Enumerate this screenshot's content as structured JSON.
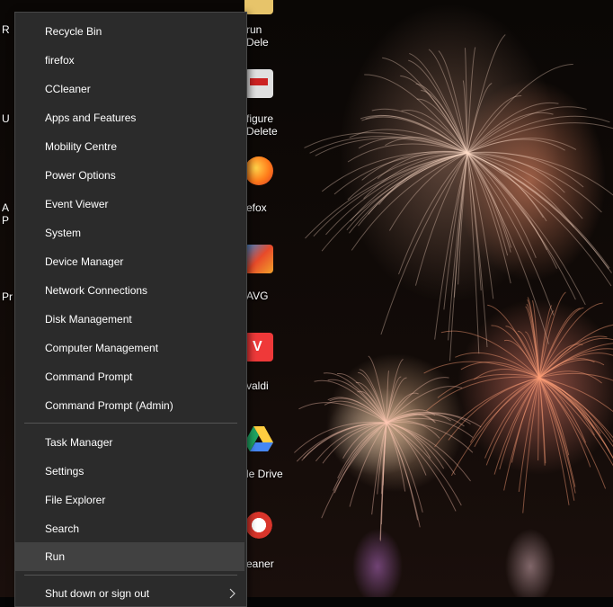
{
  "desktop": {
    "left_labels": [
      "R",
      "U",
      "A",
      "P",
      "Pr"
    ],
    "icons": [
      {
        "label_lines": [
          "run",
          "Dele"
        ],
        "icon": "run-icon",
        "color": "#e7c46a"
      },
      {
        "label_lines": [
          "figure",
          "Delete"
        ],
        "icon": "floppy-disk-icon",
        "color": "#e0e0e0"
      },
      {
        "label_lines": [
          "efox"
        ],
        "icon": "firefox-icon",
        "color": "#ff7b1a"
      },
      {
        "label_lines": [
          "AVG"
        ],
        "icon": "avg-icon",
        "color": "#e84a2a"
      },
      {
        "label_lines": [
          "valdi"
        ],
        "icon": "vivaldi-icon",
        "color": "#ef3939"
      },
      {
        "label_lines": [
          "le Drive"
        ],
        "icon": "google-drive-icon",
        "color": "#1fa463"
      },
      {
        "label_lines": [
          "eaner"
        ],
        "icon": "ccleaner-icon",
        "color": "#d9352b"
      }
    ]
  },
  "menu": {
    "group1": [
      "Recycle Bin",
      "firefox",
      "CCleaner",
      "Apps and Features",
      "Mobility Centre",
      "Power Options",
      "Event Viewer",
      "System",
      "Device Manager",
      "Network Connections",
      "Disk Management",
      "Computer Management",
      "Command Prompt",
      "Command Prompt (Admin)"
    ],
    "group2": [
      "Task Manager",
      "Settings",
      "File Explorer",
      "Search",
      "Run"
    ],
    "group3": [
      "Shut down or sign out"
    ],
    "hovered_item": "Run",
    "submenu_icon": "chevron-right-icon",
    "colors": {
      "background": "#2b2b2b",
      "hover": "#414141",
      "text": "#ffffff",
      "separator": "#545454"
    }
  }
}
